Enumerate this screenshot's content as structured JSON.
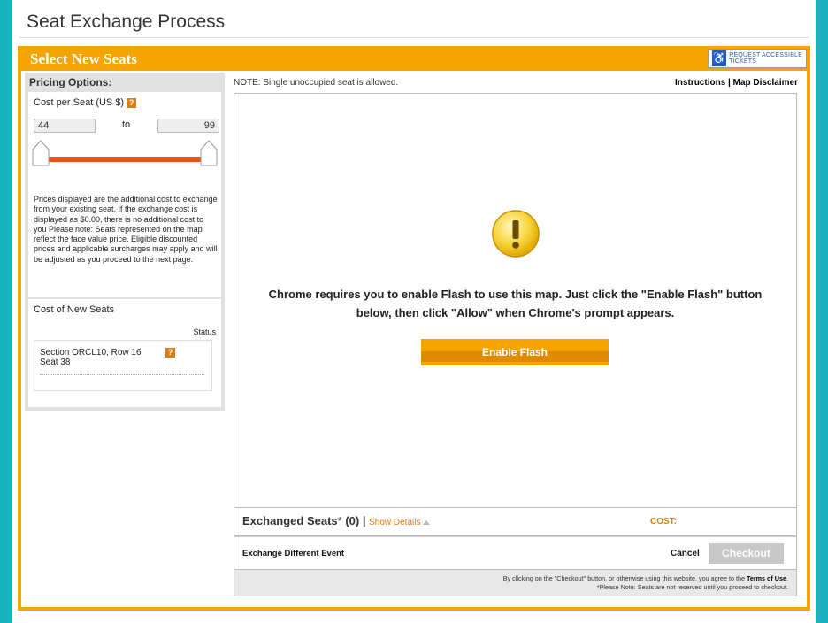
{
  "page": {
    "title": "Seat Exchange Process"
  },
  "frame": {
    "title": "Select New Seats",
    "accessible_button": "REQUEST ACCESSIBLE TICKETS"
  },
  "sidebar": {
    "heading": "Pricing Options:",
    "cost_per_seat_label": "Cost per Seat (US $)",
    "help_glyph": "?",
    "price_min": "44",
    "price_max": "99",
    "to_label": "to",
    "price_note": "Prices displayed are the additional cost to exchange from your existing seat. If the exchange cost is displayed as $0.00, there is no additional cost to you Please note: Seats represented on the map reflect the face value price. Eligible discounted prices and applicable surcharges may apply and will be adjusted as you proceed to the next page.",
    "new_seats_title": "Cost of New Seats",
    "status_label": "Status",
    "seat_line1": "Section ORCL10, Row 16",
    "seat_line2": "Seat 38"
  },
  "main": {
    "note": "NOTE: Single unoccupied seat is allowed.",
    "instructions_link": "Instructions",
    "separator": " | ",
    "map_disclaimer_link": "Map Disclaimer",
    "flash_message_line1": "Chrome requires you to enable Flash to use this map. Just click the \"Enable Flash\" button",
    "flash_message_line2": "below, then click \"Allow\" when Chrome's prompt appears.",
    "enable_flash_button": "Enable Flash"
  },
  "exchanged": {
    "title": "Exchanged Seats",
    "asterisk": "*",
    "count": " (0) ",
    "divider": "| ",
    "show_details": "Show Details",
    "cost_label": "COST:"
  },
  "actions": {
    "exchange_different_event": "Exchange Different Event",
    "cancel": "Cancel",
    "checkout": "Checkout"
  },
  "terms": {
    "line1_prefix": "By clicking on the \"Checkout\" button, or otherwise using this website, you agree to the ",
    "terms_link": "Terms of Use",
    "line1_suffix": ".",
    "line2": "*Please Note: Seats are not reserved until you proceed to checkout."
  },
  "colors": {
    "accent_orange": "#f7a400",
    "slider_range": "#e5531a",
    "page_background": "#1ab3bd",
    "disabled_button": "#c8c8c8"
  },
  "icons": [
    "wheelchair-icon",
    "help-icon",
    "warning-icon",
    "triangle-up-icon",
    "slider-handle-icon"
  ]
}
